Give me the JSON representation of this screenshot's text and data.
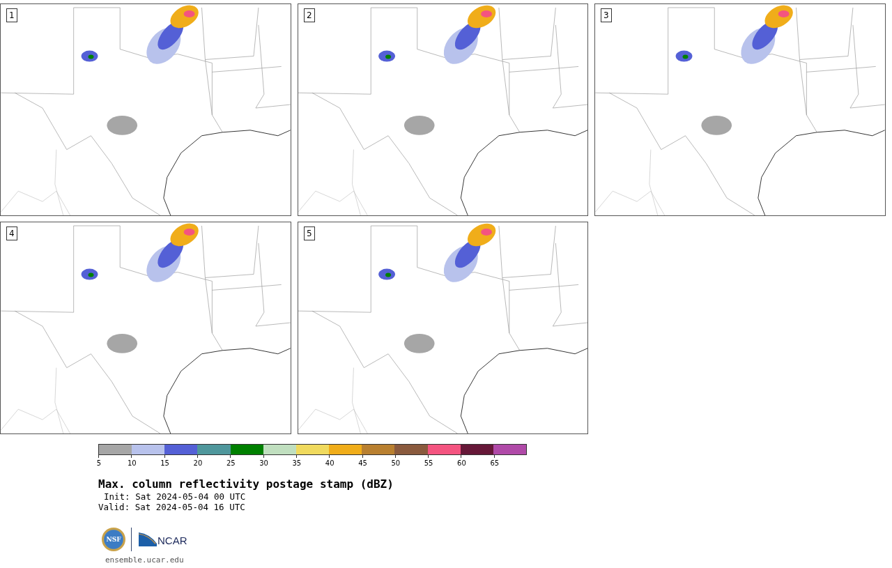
{
  "panels": [
    {
      "label": "1"
    },
    {
      "label": "2"
    },
    {
      "label": "3"
    },
    {
      "label": "4"
    },
    {
      "label": "5"
    }
  ],
  "colorbar": {
    "bins": [
      {
        "color": "#a6a6a6"
      },
      {
        "color": "#b8c2ec"
      },
      {
        "color": "#5460d6"
      },
      {
        "color": "#4f979c"
      },
      {
        "color": "#008000"
      },
      {
        "color": "#c0dfbf"
      },
      {
        "color": "#f0da5e"
      },
      {
        "color": "#f0ad1a"
      },
      {
        "color": "#b98030"
      },
      {
        "color": "#8a5a3e"
      },
      {
        "color": "#f45480"
      },
      {
        "color": "#661838"
      },
      {
        "color": "#b04aa8"
      }
    ],
    "ticks": [
      "5",
      "10",
      "15",
      "20",
      "25",
      "30",
      "35",
      "40",
      "45",
      "50",
      "55",
      "60",
      "65"
    ]
  },
  "title": "Max. column reflectivity postage stamp (dBZ)",
  "init": "Init: Sat 2024-05-04 00 UTC",
  "valid": "Valid: Sat 2024-05-04 16 UTC",
  "logos": {
    "nsf": "NSF",
    "ncar": "NCAR"
  },
  "url": "ensemble.ucar.edu"
}
